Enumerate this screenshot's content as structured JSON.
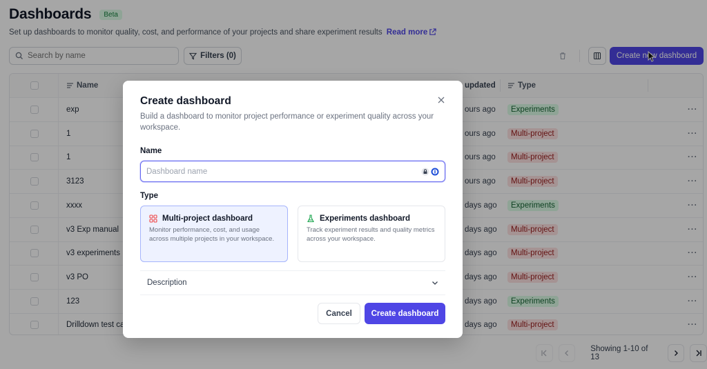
{
  "header": {
    "title": "Dashboards",
    "badge": "Beta",
    "subtitle": "Set up dashboards to monitor quality, cost, and performance of your projects and share experiment results",
    "read_more": "Read more"
  },
  "toolbar": {
    "search_placeholder": "Search by name",
    "filters_label": "Filters (0)",
    "create_label": "Create new dashboard"
  },
  "table": {
    "columns": {
      "name": "Name",
      "updated": "updated",
      "type": "Type"
    },
    "rows": [
      {
        "name": "exp",
        "updated": "ours ago",
        "type": "Experiments"
      },
      {
        "name": "1",
        "updated": "ours ago",
        "type": "Multi-project"
      },
      {
        "name": "1",
        "updated": "ours ago",
        "type": "Multi-project"
      },
      {
        "name": "3123",
        "updated": "ours ago",
        "type": "Multi-project"
      },
      {
        "name": "xxxx",
        "updated": "days ago",
        "type": "Experiments"
      },
      {
        "name": "v3 Exp manual",
        "updated": "days ago",
        "type": "Multi-project"
      },
      {
        "name": "v3 experiments",
        "updated": "days ago",
        "type": "Multi-project"
      },
      {
        "name": "v3 PO",
        "updated": "days ago",
        "type": "Multi-project"
      },
      {
        "name": "123",
        "updated": "days ago",
        "type": "Experiments"
      },
      {
        "name": "Drilldown test ca",
        "updated": "days ago",
        "type": "Multi-project"
      }
    ],
    "more_label": "···"
  },
  "pagination": {
    "showing": "Showing 1-10 of 13"
  },
  "modal": {
    "title": "Create dashboard",
    "description": "Build a dashboard to monitor project performance or experiment quality across your workspace.",
    "name_label": "Name",
    "name_placeholder": "Dashboard name",
    "name_value": "",
    "type_label": "Type",
    "types": [
      {
        "title": "Multi-project dashboard",
        "description": "Monitor performance, cost, and usage across multiple projects in your workspace.",
        "selected": true,
        "icon": "grid-icon"
      },
      {
        "title": "Experiments dashboard",
        "description": "Track experiment results and quality metrics across your workspace.",
        "selected": false,
        "icon": "flask-icon"
      }
    ],
    "description_section": "Description",
    "cancel_label": "Cancel",
    "create_label": "Create dashboard"
  },
  "colors": {
    "accent": "#4f46e5",
    "experiments_badge_bg": "#dcfce7",
    "multiproject_badge_bg": "#fee2e2"
  }
}
